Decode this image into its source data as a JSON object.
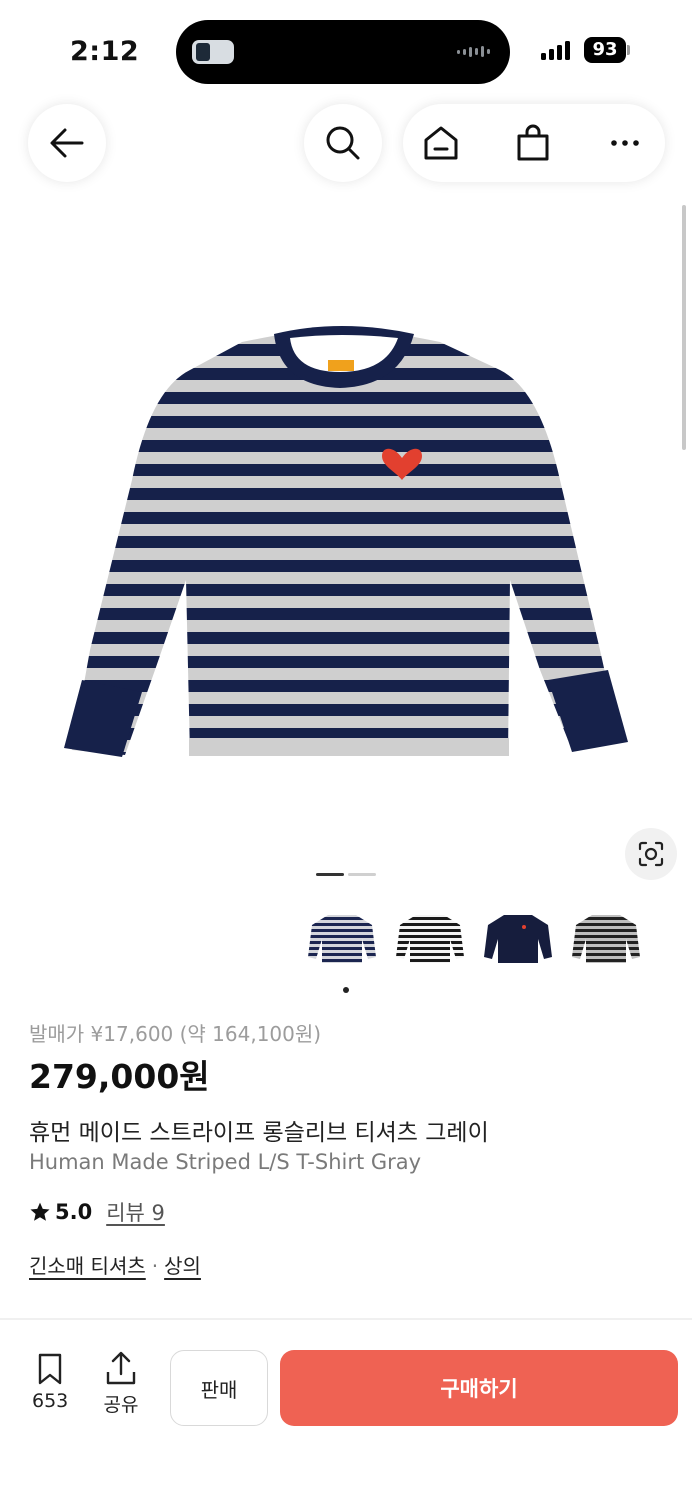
{
  "status_bar": {
    "time": "2:12",
    "battery": "93"
  },
  "nav": {
    "back_icon": "arrow-left-icon",
    "search_icon": "search-icon",
    "home_icon": "home-icon",
    "bag_icon": "shopping-bag-icon",
    "more_icon": "more-horizontal-icon"
  },
  "gallery": {
    "image": "striped-long-sleeve-shirt",
    "pages": 2,
    "current_page": 1,
    "thumbnails": [
      {
        "name": "gray-navy-stripe"
      },
      {
        "name": "white-black-stripe"
      },
      {
        "name": "navy-solid"
      },
      {
        "name": "black-gray-stripe"
      }
    ]
  },
  "product": {
    "release_price": "발매가 ¥17,600 (약 164,100원)",
    "price": "279,000원",
    "title_ko": "휴먼 메이드 스트라이프 롱슬리브 티셔츠 그레이",
    "title_en": "Human Made Striped L/S T-Shirt Gray",
    "rating": "5.0",
    "review": "리뷰 9",
    "category_1": "긴소매 티셔츠",
    "category_sep": "·",
    "category_2": "상의"
  },
  "bottom_bar": {
    "bookmark_count": "653",
    "share_label": "공유",
    "sell_label": "판매",
    "buy_label": "구매하기"
  },
  "colors": {
    "accent": "#ef6253",
    "navy": "#16214a",
    "heather": "#c9c9c9"
  }
}
